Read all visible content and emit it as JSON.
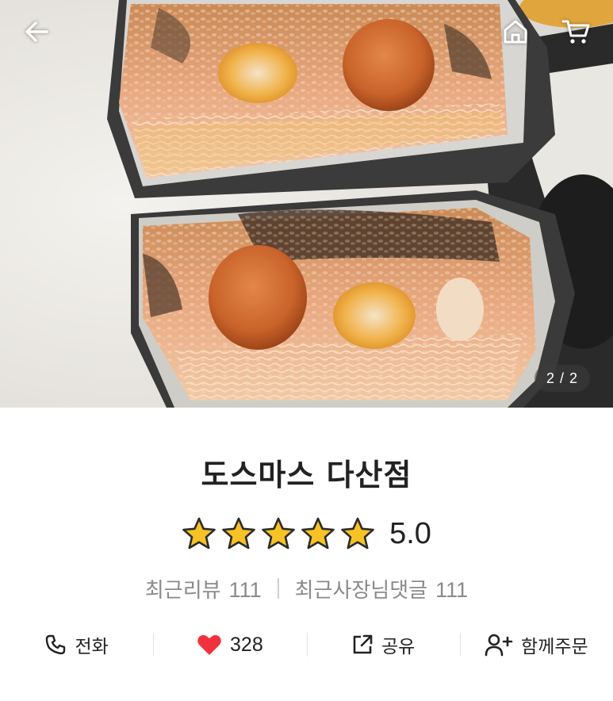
{
  "hero": {
    "photo_subject": "burrito-cross-section-photo",
    "page_indicator": "2 / 2",
    "back_icon": "arrow-left-icon",
    "home_icon": "home-icon",
    "cart_icon": "cart-icon"
  },
  "store": {
    "name": "도스마스 다산점",
    "rating": "5.0",
    "stars_filled": 5,
    "stars_total": 5,
    "star_color": "#f6c225"
  },
  "counts": {
    "recent_reviews_label": "최근리뷰",
    "recent_reviews_count": "111",
    "owner_replies_label": "최근사장님댓글",
    "owner_replies_count": "111"
  },
  "actions": {
    "call_label": "전화",
    "call_icon": "phone-icon",
    "like_count": "328",
    "like_icon": "heart-icon",
    "like_color": "#f0323c",
    "share_label": "공유",
    "share_icon": "share-icon",
    "group_order_label": "함께주문",
    "group_order_icon": "add-user-icon"
  }
}
